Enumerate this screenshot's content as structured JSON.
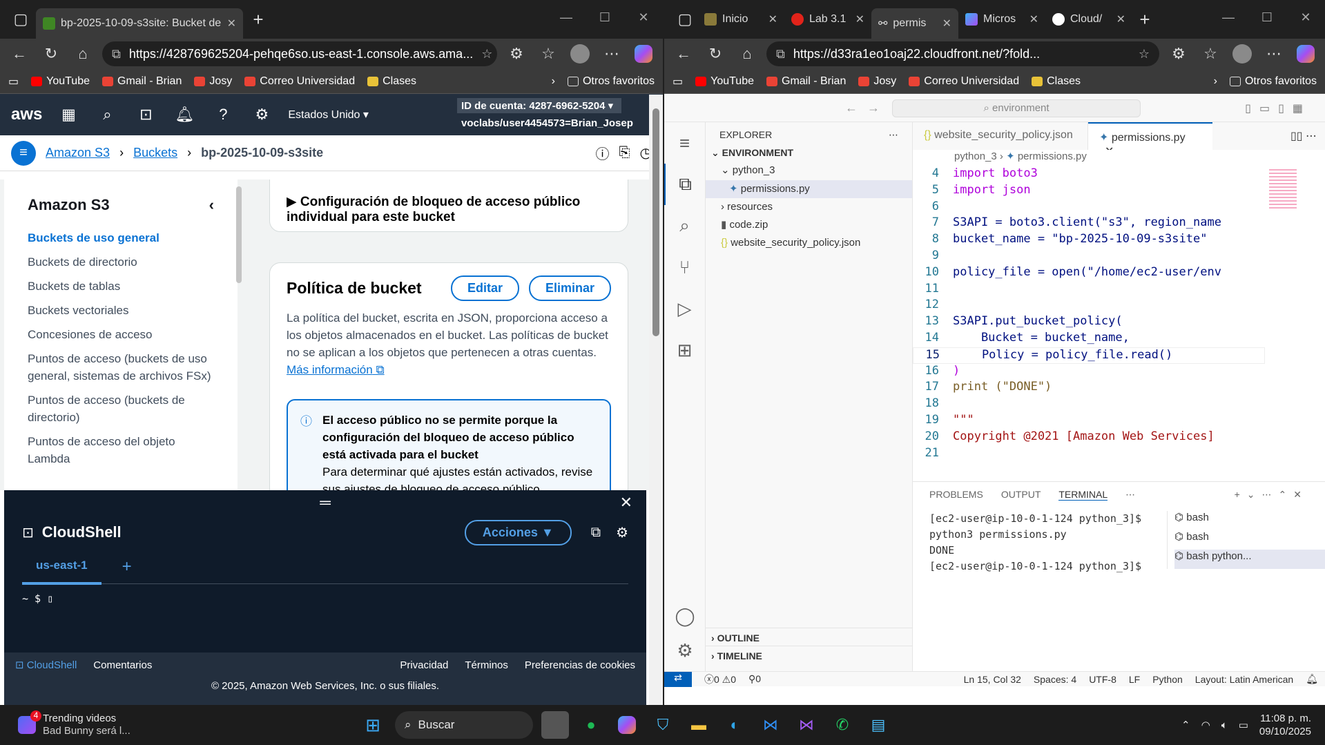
{
  "left": {
    "tabs": [
      {
        "label": "bp-2025-10-09-s3site: Bucket de"
      }
    ],
    "url": "https://428769625204-pehqe6so.us-east-1.console.aws.ama...",
    "favorites": [
      "YouTube",
      "Gmail - Brian",
      "Josy",
      "Correo Universidad",
      "Clases"
    ],
    "other_favs": "Otros favoritos",
    "aws": {
      "logo": "aws",
      "region": "Estados Unido",
      "account_label": "ID de cuenta: 4287-6962-5204",
      "user": "voclabs/user4454573=Brian_Josep"
    },
    "breadcrumb": [
      "Amazon S3",
      "Buckets",
      "bp-2025-10-09-s3site"
    ],
    "sidenav": {
      "title": "Amazon S3",
      "items": [
        "Buckets de uso general",
        "Buckets de directorio",
        "Buckets de tablas",
        "Buckets vectoriales",
        "Concesiones de acceso",
        "Puntos de acceso (buckets de uso general, sistemas de archivos FSx)",
        "Puntos de acceso (buckets de directorio)",
        "Puntos de acceso del objeto Lambda"
      ]
    },
    "block_title": "Configuración de bloqueo de acceso público individual para este bucket",
    "policy": {
      "title": "Política de bucket",
      "edit": "Editar",
      "delete": "Eliminar",
      "desc": "La política del bucket, escrita en JSON, proporciona acceso a los objetos almacenados en el bucket. Las políticas de bucket no se aplican a los objetos que pertenecen a otras cuentas.",
      "link": "Más información",
      "alert_title": "El acceso público no se permite porque la configuración del bloqueo de acceso público está activada para el bucket",
      "alert_body": "Para determinar qué ajustes están activados, revise sus ajustes de bloqueo de acceso público"
    },
    "cloudshell": {
      "title": "CloudShell",
      "actions": "Acciones",
      "tab": "us-east-1",
      "prompt": "~ $"
    },
    "footer": {
      "cs": "CloudShell",
      "comments": "Comentarios",
      "privacy": "Privacidad",
      "terms": "Términos",
      "cookies": "Preferencias de cookies",
      "copy": "© 2025, Amazon Web Services, Inc. o sus filiales."
    }
  },
  "right": {
    "tabs": [
      {
        "label": "Inicio"
      },
      {
        "label": "Lab 3.1"
      },
      {
        "label": "permis"
      },
      {
        "label": "Micros"
      },
      {
        "label": "Cloud/"
      }
    ],
    "url": "https://d33ra1eo1oaj22.cloudfront.net/?fold...",
    "favorites": [
      "YouTube",
      "Gmail - Brian",
      "Josy",
      "Correo Universidad",
      "Clases"
    ],
    "other_favs": "Otros favoritos",
    "search": "environment",
    "explorer": {
      "title": "EXPLORER",
      "root": "ENVIRONMENT",
      "folder": "python_3",
      "file_active": "permissions.py",
      "resources": "resources",
      "zip": "code.zip",
      "json": "website_security_policy.json",
      "outline": "OUTLINE",
      "timeline": "TIMELINE"
    },
    "editor_tabs": [
      "website_security_policy.json",
      "permissions.py"
    ],
    "path": [
      "python_3",
      "permissions.py"
    ],
    "code": [
      {
        "n": "4",
        "t": "import boto3"
      },
      {
        "n": "5",
        "t": "import json"
      },
      {
        "n": "6",
        "t": ""
      },
      {
        "n": "7",
        "t": "S3API = boto3.client(\"s3\", region_name"
      },
      {
        "n": "8",
        "t": "bucket_name = \"bp-2025-10-09-s3site\""
      },
      {
        "n": "9",
        "t": ""
      },
      {
        "n": "10",
        "t": "policy_file = open(\"/home/ec2-user/env"
      },
      {
        "n": "11",
        "t": ""
      },
      {
        "n": "12",
        "t": ""
      },
      {
        "n": "13",
        "t": "S3API.put_bucket_policy("
      },
      {
        "n": "14",
        "t": "    Bucket = bucket_name,"
      },
      {
        "n": "15",
        "t": "    Policy = policy_file.read()"
      },
      {
        "n": "16",
        "t": ")"
      },
      {
        "n": "17",
        "t": "print (\"DONE\")"
      },
      {
        "n": "18",
        "t": ""
      },
      {
        "n": "19",
        "t": "\"\"\""
      },
      {
        "n": "20",
        "t": "Copyright @2021 [Amazon Web Services]"
      },
      {
        "n": "21",
        "t": ""
      }
    ],
    "panel_tabs": [
      "PROBLEMS",
      "OUTPUT",
      "TERMINAL"
    ],
    "terminal": [
      "[ec2-user@ip-10-0-1-124 python_3]$",
      "python3 permissions.py",
      "DONE",
      "[ec2-user@ip-10-0-1-124 python_3]$"
    ],
    "terms": [
      "bash",
      "bash",
      "bash python..."
    ],
    "status": {
      "problems": "0 ⚠0",
      "ports": "0",
      "pos": "Ln 15, Col 32",
      "spaces": "Spaces: 4",
      "enc": "UTF-8",
      "eol": "LF",
      "lang": "Python",
      "layout": "Layout: Latin American"
    }
  },
  "taskbar": {
    "news_title": "Trending videos",
    "news_sub": "Bad Bunny será l...",
    "badge": "4",
    "search": "Buscar",
    "time": "11:08 p. m.",
    "date": "09/10/2025"
  }
}
